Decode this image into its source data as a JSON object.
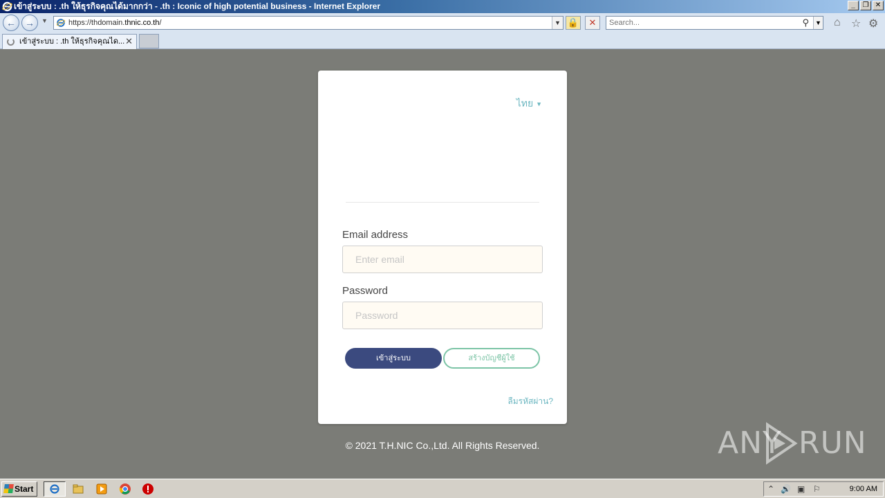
{
  "browser": {
    "window_title": "เข้าสู่ระบบ : .th ให้ธุรกิจคุณได้มากกว่า - .th : Iconic of high potential business - Internet Explorer",
    "url_prefix": "https://thdomain.",
    "url_domain": "thnic.co.th",
    "url_suffix": "/",
    "search_placeholder": "Search...",
    "tab_title": "เข้าสู่ระบบ : .th ให้ธุรกิจคุณได...",
    "controls": {
      "minimize": "_",
      "restore": "❐",
      "close": "✕"
    }
  },
  "login": {
    "language": "ไทย",
    "email_label": "Email address",
    "email_placeholder": "Enter email",
    "password_label": "Password",
    "password_placeholder": "Password",
    "login_button": "เข้าสู่ระบบ",
    "register_button": "สร้างบัญชีผู้ใช้",
    "forgot_link": "ลืมรหัสผ่าน?"
  },
  "footer": {
    "copyright": "© 2021 T.H.NIC Co.,Ltd. All Rights Reserved."
  },
  "watermark": {
    "left": "ANY",
    "right": "RUN"
  },
  "taskbar": {
    "start_label": "Start",
    "clock": "9:00 AM"
  },
  "colors": {
    "page_background": "#7b7c77",
    "primary_button": "#3b4a7f",
    "secondary_button": "#7cc4a6",
    "link": "#6bb6c0"
  }
}
